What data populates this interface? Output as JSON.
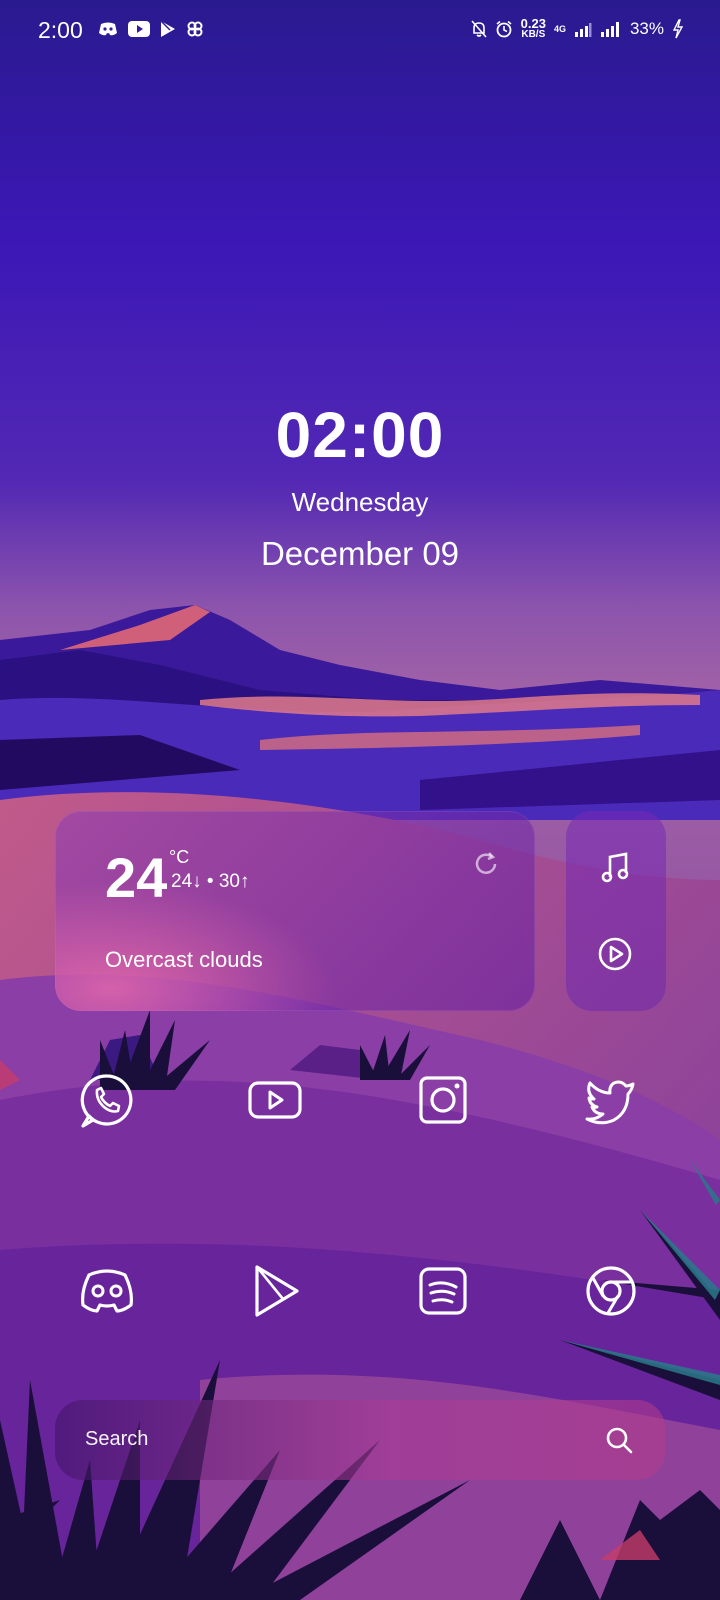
{
  "status_bar": {
    "time": "2:00",
    "notification_icons": [
      "discord-icon",
      "youtube-icon",
      "play-store-icon",
      "pinwheel-icon"
    ],
    "status_icons": [
      "mute-bell-icon",
      "alarm-icon",
      "data-speed",
      "4g-signal-icon",
      "signal-icon",
      "battery-charging-icon"
    ],
    "speed_value": "0.23",
    "speed_unit": "KB/S",
    "network_tag": "4G",
    "battery": "33%"
  },
  "clock": {
    "time": "02:00",
    "day": "Wednesday",
    "date": "December 09"
  },
  "weather": {
    "temperature": "24",
    "unit": "°C",
    "range": "24↓ • 30↑",
    "description": "Overcast clouds",
    "refresh_icon": "refresh-icon"
  },
  "music": {
    "icons": [
      "music-note-icon",
      "play-circle-icon"
    ]
  },
  "apps_row1": [
    {
      "icon": "whatsapp-icon"
    },
    {
      "icon": "youtube-icon"
    },
    {
      "icon": "instagram-icon"
    },
    {
      "icon": "twitter-icon"
    }
  ],
  "apps_row2": [
    {
      "icon": "discord-icon"
    },
    {
      "icon": "play-store-icon"
    },
    {
      "icon": "spotify-icon"
    },
    {
      "icon": "chrome-icon"
    }
  ],
  "search": {
    "label": "Search",
    "icon": "search-icon"
  },
  "colors": {
    "sky_top": "#2a1a8f",
    "sky_mid": "#5a2ab0",
    "sky_horizon": "#9a5aa8",
    "mountain": "#3a1a9a",
    "sand_light": "#c15a8a",
    "dark_plant": "#1a0f3a"
  }
}
